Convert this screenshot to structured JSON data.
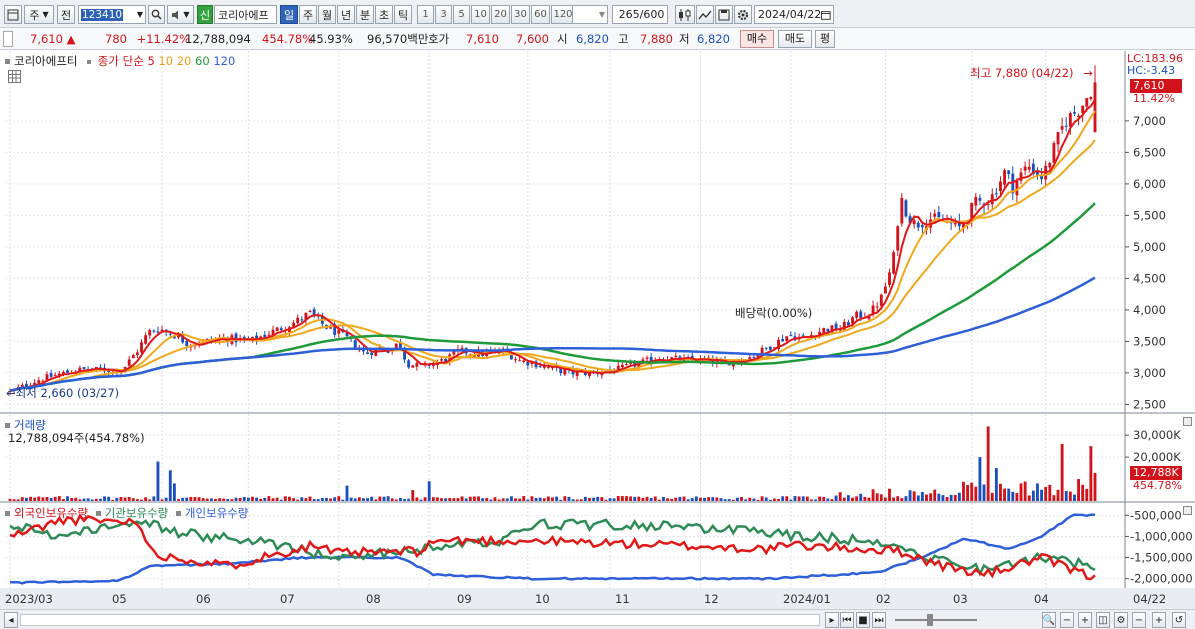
{
  "toolbar": {
    "type_label": "주",
    "prev_label": "전",
    "code_value": "123410",
    "stock_badge": "신",
    "stock_name": "코리아에프",
    "periods": [
      "일",
      "주",
      "월",
      "년",
      "분",
      "초",
      "틱"
    ],
    "active_period": "일",
    "intervals": [
      "1",
      "3",
      "5",
      "10",
      "20",
      "30",
      "60",
      "120"
    ],
    "count_value": "265",
    "count_total": "/600",
    "date_value": "2024/04/22"
  },
  "quote": {
    "price": "7,610",
    "change": "780",
    "change_pct": "+11.42%",
    "volume": "12,788,094",
    "volume_pct": "454.78%",
    "turnover": "45.93%",
    "amount": "96,570백만",
    "bid_label": "호가",
    "ask": "7,610",
    "bid": "7,600",
    "open_label": "시",
    "open": "6,820",
    "high_label": "고",
    "high": "7,880",
    "low_label": "저",
    "low": "6,820",
    "buy_label": "매수",
    "sell_label": "매도",
    "flat_label": "평"
  },
  "price_panel": {
    "name": "코리아에프티",
    "ma_label": "종가 단순",
    "ma_periods": [
      "5",
      "10",
      "20",
      "60",
      "120"
    ],
    "lc_label": "LC:183.96",
    "hc_label": "HC:-3.43",
    "current_price_tag": "7,610",
    "current_pct_tag": "11.42%",
    "high_annotation": "최고 7,880 (04/22)",
    "low_annotation": "최저 2,660 (03/27)",
    "dividend_annotation": "배당락(0.00%)",
    "y_ticks": [
      "7,000",
      "6,500",
      "6,000",
      "5,500",
      "5,000",
      "4,500",
      "4,000",
      "3,500",
      "3,000",
      "2,500"
    ]
  },
  "volume_panel": {
    "title": "거래량",
    "subtitle": "12,788,094주(454.78%)",
    "y_ticks": [
      "30,000K",
      "20,000K"
    ],
    "current_tag": "12,788K",
    "current_pct": "454.78%"
  },
  "holdings_panel": {
    "series_labels": [
      "외국인보유수량",
      "기관보유수량",
      "개인보유수량"
    ],
    "y_ticks": [
      "-500,000",
      "-1,000,000",
      "-1,500,000",
      "-2,000,000"
    ]
  },
  "x_axis": {
    "labels": [
      "2023/03",
      "05",
      "06",
      "07",
      "08",
      "09",
      "10",
      "11",
      "12",
      "2024/01",
      "02",
      "03",
      "04"
    ],
    "last_date": "04/22"
  },
  "colors": {
    "up": "#d1141b",
    "down": "#1a4fbd",
    "ma5": "#e01818",
    "ma10": "#f0a81c",
    "ma20": "#f0a81c",
    "ma60": "#1f9a3a",
    "ma120": "#2e5fd8",
    "foreign": "#e01818",
    "institution": "#2e8b57",
    "individual": "#2e5fd8"
  },
  "chart_data": {
    "type": "line",
    "title": "코리아에프티",
    "x": [
      "2023/03",
      "05",
      "06",
      "07",
      "08",
      "09",
      "10",
      "11",
      "12",
      "2024/01",
      "02",
      "03",
      "04"
    ],
    "series": [
      {
        "name": "종가",
        "values": [
          2700,
          3650,
          3500,
          4000,
          3300,
          3350,
          3050,
          3150,
          3250,
          3700,
          5800,
          5400,
          7610
        ]
      },
      {
        "name": "60",
        "values": [
          2750,
          3100,
          3350,
          3500,
          3450,
          3350,
          3200,
          3150,
          3150,
          3250,
          3700,
          4600,
          5500
        ]
      },
      {
        "name": "120",
        "values": [
          2700,
          2850,
          3050,
          3250,
          3350,
          3350,
          3300,
          3250,
          3200,
          3200,
          3350,
          3800,
          4400
        ]
      }
    ],
    "ylim": [
      2500,
      7900
    ]
  }
}
